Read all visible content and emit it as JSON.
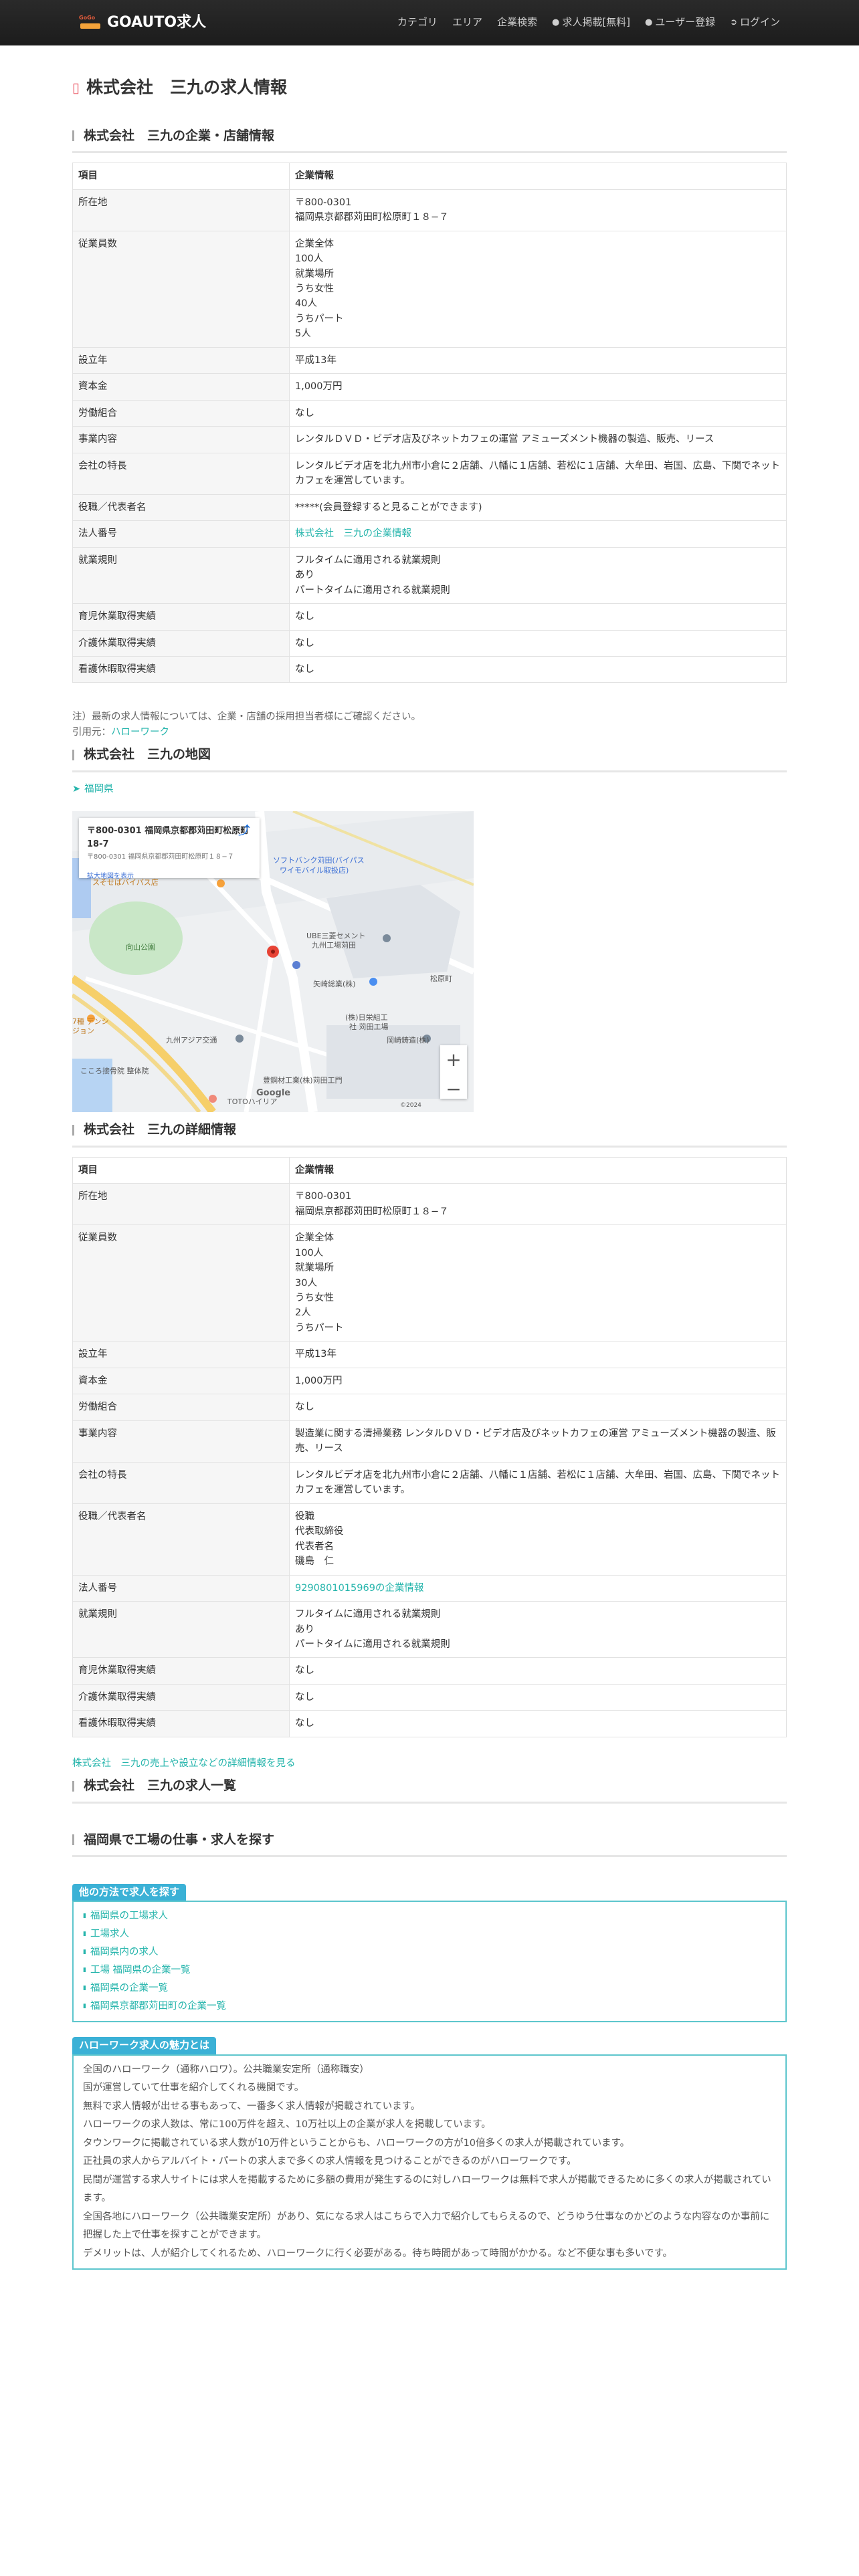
{
  "navbar": {
    "logo_sub": "GoGo",
    "brand": "GOAUTO求人",
    "items": [
      {
        "label": "カテゴリ"
      },
      {
        "label": "エリア"
      },
      {
        "label": "企業検索"
      },
      {
        "label": "求人掲載[無料]"
      },
      {
        "label": "ユーザー登録"
      },
      {
        "label": "ログイン"
      }
    ]
  },
  "page_title": "株式会社　三九の求人情報",
  "company_section": {
    "heading": "株式会社　三九の企業・店舗情報",
    "header": {
      "k": "項目",
      "v": "企業情報"
    },
    "rows": [
      {
        "k": "所在地",
        "v": "〒800-0301\n福岡県京都郡苅田町松原町１８−７"
      },
      {
        "k": "従業員数",
        "v": "企業全体\n100人\n就業場所\nうち女性\n40人\nうちパート\n5人"
      },
      {
        "k": "設立年",
        "v": "平成13年"
      },
      {
        "k": "資本金",
        "v": "1,000万円"
      },
      {
        "k": "労働組合",
        "v": "なし"
      },
      {
        "k": "事業内容",
        "v": "レンタルＤＶＤ・ビデオ店及びネットカフェの運営 アミューズメント機器の製造、販売、リース"
      },
      {
        "k": "会社の特長",
        "v": "レンタルビデオ店を北九州市小倉に２店舗、八幡に１店舗、若松に１店舗、大牟田、岩国、広島、下関でネットカフェを運営しています。"
      },
      {
        "k": "役職／代表者名",
        "v": "*****(会員登録すると見ることができます)"
      },
      {
        "k": "法人番号",
        "v": "株式会社　三九の企業情報",
        "link": true
      },
      {
        "k": "就業規則",
        "v": "フルタイムに適用される就業規則\nあり\nパートタイムに適用される就業規則"
      },
      {
        "k": "育児休業取得実績",
        "v": "なし"
      },
      {
        "k": "介護休業取得実績",
        "v": "なし"
      },
      {
        "k": "看護休暇取得実績",
        "v": "なし"
      }
    ]
  },
  "note": "注）最新の求人情報については、企業・店舗の採用担当者様にご確認ください。",
  "cite_label": "引用元：",
  "cite_link": "ハローワーク",
  "map_section": {
    "heading": "株式会社　三九の地図",
    "location_link": "福岡県",
    "card_title": "〒800-0301 福岡県京都郡苅田町松原町18-7",
    "card_sub": "〒800-0301 福岡県京都郡苅田町松原町１８−７",
    "card_link": "拡大地図を表示",
    "labels": [
      "ソフトバンク苅田(バイパス",
      "ワイモバイル取扱店)",
      "スそせばバイパス店",
      "向山公園",
      "UBE三菱セメント",
      "九州工場苅田",
      "矢崎総業(株)",
      "松原町",
      "(株)日栄組工",
      "社 苅田工場",
      "岡崎鋳造(株)",
      "九州アジア交通",
      "豊鋼材工業(株)苅田工門",
      "こころ接骨院 整体院",
      "TOTOハイリア",
      "7種 デンシ",
      "ジョン",
      "Google",
      "©2024"
    ],
    "zoom_in": "+",
    "zoom_out": "−"
  },
  "detail_section": {
    "heading": "株式会社　三九の詳細情報",
    "header": {
      "k": "項目",
      "v": "企業情報"
    },
    "rows": [
      {
        "k": "所在地",
        "v": "〒800-0301\n福岡県京都郡苅田町松原町１８−７"
      },
      {
        "k": "従業員数",
        "v": "企業全体\n100人\n就業場所\n30人\nうち女性\n2人\nうちパート"
      },
      {
        "k": "設立年",
        "v": "平成13年"
      },
      {
        "k": "資本金",
        "v": "1,000万円"
      },
      {
        "k": "労働組合",
        "v": "なし"
      },
      {
        "k": "事業内容",
        "v": "製造業に関する清掃業務 レンタルＤＶＤ・ビデオ店及びネットカフェの運営 アミューズメント機器の製造、販売、リース"
      },
      {
        "k": "会社の特長",
        "v": "レンタルビデオ店を北九州市小倉に２店舗、八幡に１店舗、若松に１店舗、大牟田、岩国、広島、下関でネットカフェを運営しています。"
      },
      {
        "k": "役職／代表者名",
        "v": "役職\n代表取締役\n代表者名\n磯島　仁"
      },
      {
        "k": "法人番号",
        "v": "9290801015969の企業情報",
        "link": true
      },
      {
        "k": "就業規則",
        "v": "フルタイムに適用される就業規則\nあり\nパートタイムに適用される就業規則"
      },
      {
        "k": "育児休業取得実績",
        "v": "なし"
      },
      {
        "k": "介護休業取得実績",
        "v": "なし"
      },
      {
        "k": "看護休暇取得実績",
        "v": "なし"
      }
    ]
  },
  "detail_more_link": "株式会社　三九の売上や設立などの詳細情報を見る",
  "jobs_heading": "株式会社　三九の求人一覧",
  "factory_heading": "福岡県で工場の仕事・求人を探す",
  "other_box": {
    "title": "他の方法で求人を探す",
    "items": [
      "福岡県の工場求人",
      "工場求人",
      "福岡県内の求人",
      "工場 福岡県の企業一覧",
      "福岡県の企業一覧",
      "福岡県京都郡苅田町の企業一覧"
    ]
  },
  "hw_box": {
    "title": "ハローワーク求人の魅力とは",
    "paras": [
      "全国のハローワーク（通称ハロワ）。公共職業安定所（通称職安）",
      "国が運営していて仕事を紹介してくれる機関です。",
      "無料で求人情報が出せる事もあって、一番多く求人情報が掲載されています。",
      "ハローワークの求人数は、常に100万件を超え、10万社以上の企業が求人を掲載しています。",
      "タウンワークに掲載されている求人数が10万件ということからも、ハローワークの方が10倍多くの求人が掲載されています。",
      "正社員の求人からアルバイト・パートの求人まで多くの求人情報を見つけることができるのがハローワークです。",
      "民間が運営する求人サイトには求人を掲載するために多額の費用が発生するのに対しハローワークは無料で求人が掲載できるために多くの求人が掲載されています。",
      "全国各地にハローワーク（公共職業安定所）があり、気になる求人はこちらで入力で紹介してもらえるので、どうゆう仕事なのかどのような内容なのか事前に把握した上で仕事を探すことができます。",
      "デメリットは、人が紹介してくれるため、ハローワークに行く必要がある。待ち時間があって時間がかかる。など不便な事も多いです。"
    ]
  }
}
